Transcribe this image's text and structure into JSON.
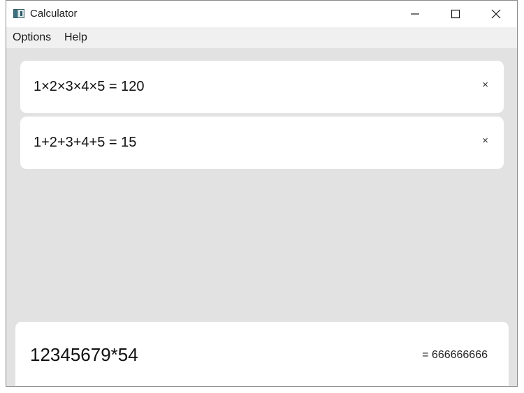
{
  "window": {
    "title": "Calculator"
  },
  "menu": {
    "items": [
      {
        "label": "Options"
      },
      {
        "label": "Help"
      }
    ]
  },
  "history": [
    {
      "expression": "1×2×3×4×5 = 120",
      "remove_glyph": "×"
    },
    {
      "expression": "1+2+3+4+5 = 15",
      "remove_glyph": "×"
    }
  ],
  "input": {
    "expression": "12345679*54",
    "preview": "= 666666666"
  },
  "icons": {
    "app": "calculator-app-icon",
    "minimize": "minimize-icon",
    "maximize": "maximize-icon",
    "close": "close-icon"
  }
}
